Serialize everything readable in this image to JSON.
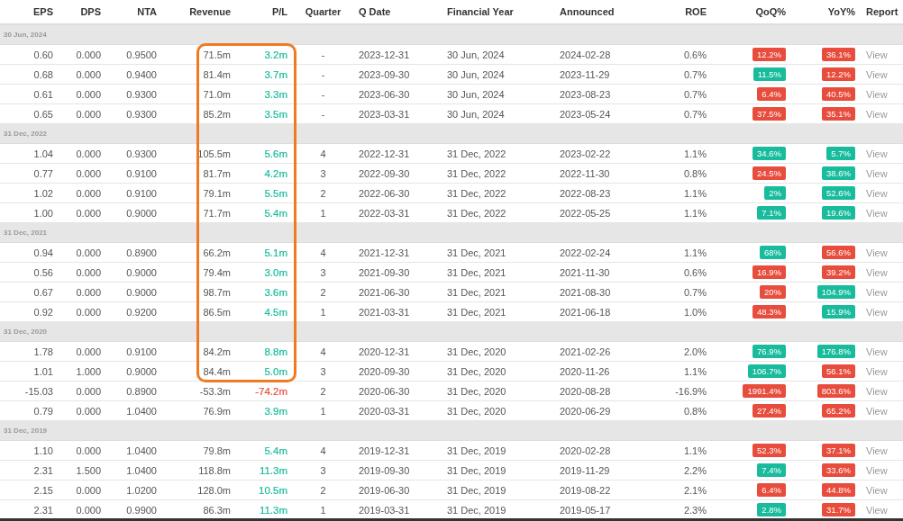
{
  "columns": [
    "EPS",
    "DPS",
    "NTA",
    "Revenue",
    "P/L",
    "Quarter",
    "Q Date",
    "Financial Year",
    "Announced",
    "ROE",
    "QoQ%",
    "YoY%",
    "Report"
  ],
  "groups": [
    {
      "label": "30 Jun, 2024",
      "rows": [
        {
          "eps": "0.60",
          "dps": "0.000",
          "nta": "0.9500",
          "revenue": "71.5m",
          "pl": {
            "text": "3.2m",
            "color": "#18bc9c"
          },
          "quarter": "-",
          "q_date": "2023-12-31",
          "financial_year": "30 Jun, 2024",
          "announced": "2024-02-28",
          "roe": "0.6%",
          "qoq": {
            "text": "12.2%",
            "color": "#e74c3c"
          },
          "yoy": {
            "text": "36.1%",
            "color": "#e74c3c"
          },
          "report": "View",
          "highlighted": true
        },
        {
          "eps": "0.68",
          "dps": "0.000",
          "nta": "0.9400",
          "revenue": "81.4m",
          "pl": {
            "text": "3.7m",
            "color": "#18bc9c"
          },
          "quarter": "-",
          "q_date": "2023-09-30",
          "financial_year": "30 Jun, 2024",
          "announced": "2023-11-29",
          "roe": "0.7%",
          "qoq": {
            "text": "11.5%",
            "color": "#18bc9c"
          },
          "yoy": {
            "text": "12.2%",
            "color": "#e74c3c"
          },
          "report": "View",
          "highlighted": true
        },
        {
          "eps": "0.61",
          "dps": "0.000",
          "nta": "0.9300",
          "revenue": "71.0m",
          "pl": {
            "text": "3.3m",
            "color": "#18bc9c"
          },
          "quarter": "-",
          "q_date": "2023-06-30",
          "financial_year": "30 Jun, 2024",
          "announced": "2023-08-23",
          "roe": "0.7%",
          "qoq": {
            "text": "6.4%",
            "color": "#e74c3c"
          },
          "yoy": {
            "text": "40.5%",
            "color": "#e74c3c"
          },
          "report": "View",
          "highlighted": true
        },
        {
          "eps": "0.65",
          "dps": "0.000",
          "nta": "0.9300",
          "revenue": "85.2m",
          "pl": {
            "text": "3.5m",
            "color": "#18bc9c"
          },
          "quarter": "-",
          "q_date": "2023-03-31",
          "financial_year": "30 Jun, 2024",
          "announced": "2023-05-24",
          "roe": "0.7%",
          "qoq": {
            "text": "37.5%",
            "color": "#e74c3c"
          },
          "yoy": {
            "text": "35.1%",
            "color": "#e74c3c"
          },
          "report": "View",
          "highlighted": true
        }
      ]
    },
    {
      "label": "31 Dec, 2022",
      "rows": [
        {
          "eps": "1.04",
          "dps": "0.000",
          "nta": "0.9300",
          "revenue": "105.5m",
          "pl": {
            "text": "5.6m",
            "color": "#18bc9c"
          },
          "quarter": "4",
          "q_date": "2022-12-31",
          "financial_year": "31 Dec, 2022",
          "announced": "2023-02-22",
          "roe": "1.1%",
          "qoq": {
            "text": "34.6%",
            "color": "#18bc9c"
          },
          "yoy": {
            "text": "5.7%",
            "color": "#18bc9c"
          },
          "report": "View",
          "highlighted": true
        },
        {
          "eps": "0.77",
          "dps": "0.000",
          "nta": "0.9100",
          "revenue": "81.7m",
          "pl": {
            "text": "4.2m",
            "color": "#18bc9c"
          },
          "quarter": "3",
          "q_date": "2022-09-30",
          "financial_year": "31 Dec, 2022",
          "announced": "2022-11-30",
          "roe": "0.8%",
          "qoq": {
            "text": "24.5%",
            "color": "#e74c3c"
          },
          "yoy": {
            "text": "38.6%",
            "color": "#18bc9c"
          },
          "report": "View",
          "highlighted": true
        },
        {
          "eps": "1.02",
          "dps": "0.000",
          "nta": "0.9100",
          "revenue": "79.1m",
          "pl": {
            "text": "5.5m",
            "color": "#18bc9c"
          },
          "quarter": "2",
          "q_date": "2022-06-30",
          "financial_year": "31 Dec, 2022",
          "announced": "2022-08-23",
          "roe": "1.1%",
          "qoq": {
            "text": "2%",
            "color": "#18bc9c"
          },
          "yoy": {
            "text": "52.6%",
            "color": "#18bc9c"
          },
          "report": "View",
          "highlighted": true
        },
        {
          "eps": "1.00",
          "dps": "0.000",
          "nta": "0.9000",
          "revenue": "71.7m",
          "pl": {
            "text": "5.4m",
            "color": "#18bc9c"
          },
          "quarter": "1",
          "q_date": "2022-03-31",
          "financial_year": "31 Dec, 2022",
          "announced": "2022-05-25",
          "roe": "1.1%",
          "qoq": {
            "text": "7.1%",
            "color": "#18bc9c"
          },
          "yoy": {
            "text": "19.6%",
            "color": "#18bc9c"
          },
          "report": "View",
          "highlighted": true
        }
      ]
    },
    {
      "label": "31 Dec, 2021",
      "rows": [
        {
          "eps": "0.94",
          "dps": "0.000",
          "nta": "0.8900",
          "revenue": "66.2m",
          "pl": {
            "text": "5.1m",
            "color": "#18bc9c"
          },
          "quarter": "4",
          "q_date": "2021-12-31",
          "financial_year": "31 Dec, 2021",
          "announced": "2022-02-24",
          "roe": "1.1%",
          "qoq": {
            "text": "68%",
            "color": "#18bc9c"
          },
          "yoy": {
            "text": "56.6%",
            "color": "#e74c3c"
          },
          "report": "View",
          "highlighted": true
        },
        {
          "eps": "0.56",
          "dps": "0.000",
          "nta": "0.9000",
          "revenue": "79.4m",
          "pl": {
            "text": "3.0m",
            "color": "#18bc9c"
          },
          "quarter": "3",
          "q_date": "2021-09-30",
          "financial_year": "31 Dec, 2021",
          "announced": "2021-11-30",
          "roe": "0.6%",
          "qoq": {
            "text": "16.9%",
            "color": "#e74c3c"
          },
          "yoy": {
            "text": "39.2%",
            "color": "#e74c3c"
          },
          "report": "View",
          "highlighted": true
        },
        {
          "eps": "0.67",
          "dps": "0.000",
          "nta": "0.9000",
          "revenue": "98.7m",
          "pl": {
            "text": "3.6m",
            "color": "#18bc9c"
          },
          "quarter": "2",
          "q_date": "2021-06-30",
          "financial_year": "31 Dec, 2021",
          "announced": "2021-08-30",
          "roe": "0.7%",
          "qoq": {
            "text": "20%",
            "color": "#e74c3c"
          },
          "yoy": {
            "text": "104.9%",
            "color": "#18bc9c"
          },
          "report": "View",
          "highlighted": true
        },
        {
          "eps": "0.92",
          "dps": "0.000",
          "nta": "0.9200",
          "revenue": "86.5m",
          "pl": {
            "text": "4.5m",
            "color": "#18bc9c"
          },
          "quarter": "1",
          "q_date": "2021-03-31",
          "financial_year": "31 Dec, 2021",
          "announced": "2021-06-18",
          "roe": "1.0%",
          "qoq": {
            "text": "48.3%",
            "color": "#e74c3c"
          },
          "yoy": {
            "text": "15.9%",
            "color": "#18bc9c"
          },
          "report": "View",
          "highlighted": true
        }
      ]
    },
    {
      "label": "31 Dec, 2020",
      "rows": [
        {
          "eps": "1.78",
          "dps": "0.000",
          "nta": "0.9100",
          "revenue": "84.2m",
          "pl": {
            "text": "8.8m",
            "color": "#18bc9c"
          },
          "quarter": "4",
          "q_date": "2020-12-31",
          "financial_year": "31 Dec, 2020",
          "announced": "2021-02-26",
          "roe": "2.0%",
          "qoq": {
            "text": "76.9%",
            "color": "#18bc9c"
          },
          "yoy": {
            "text": "176.8%",
            "color": "#18bc9c"
          },
          "report": "View",
          "highlighted": true
        },
        {
          "eps": "1.01",
          "dps": "1.000",
          "nta": "0.9000",
          "revenue": "84.4m",
          "pl": {
            "text": "5.0m",
            "color": "#18bc9c"
          },
          "quarter": "3",
          "q_date": "2020-09-30",
          "financial_year": "31 Dec, 2020",
          "announced": "2020-11-26",
          "roe": "1.1%",
          "qoq": {
            "text": "106.7%",
            "color": "#18bc9c"
          },
          "yoy": {
            "text": "56.1%",
            "color": "#e74c3c"
          },
          "report": "View",
          "highlighted": true
        },
        {
          "eps": "-15.03",
          "dps": "0.000",
          "nta": "0.8900",
          "revenue": "-53.3m",
          "pl": {
            "text": "-74.2m",
            "color": "#e74c3c"
          },
          "quarter": "2",
          "q_date": "2020-06-30",
          "financial_year": "31 Dec, 2020",
          "announced": "2020-08-28",
          "roe": "-16.9%",
          "qoq": {
            "text": "1991.4%",
            "color": "#e74c3c"
          },
          "yoy": {
            "text": "803.6%",
            "color": "#e74c3c"
          },
          "report": "View",
          "highlighted": false
        },
        {
          "eps": "0.79",
          "dps": "0.000",
          "nta": "1.0400",
          "revenue": "76.9m",
          "pl": {
            "text": "3.9m",
            "color": "#18bc9c"
          },
          "quarter": "1",
          "q_date": "2020-03-31",
          "financial_year": "31 Dec, 2020",
          "announced": "2020-06-29",
          "roe": "0.8%",
          "qoq": {
            "text": "27.4%",
            "color": "#e74c3c"
          },
          "yoy": {
            "text": "65.2%",
            "color": "#e74c3c"
          },
          "report": "View",
          "highlighted": false
        }
      ]
    },
    {
      "label": "31 Dec, 2019",
      "rows": [
        {
          "eps": "1.10",
          "dps": "0.000",
          "nta": "1.0400",
          "revenue": "79.8m",
          "pl": {
            "text": "5.4m",
            "color": "#18bc9c"
          },
          "quarter": "4",
          "q_date": "2019-12-31",
          "financial_year": "31 Dec, 2019",
          "announced": "2020-02-28",
          "roe": "1.1%",
          "qoq": {
            "text": "52.3%",
            "color": "#e74c3c"
          },
          "yoy": {
            "text": "37.1%",
            "color": "#e74c3c"
          },
          "report": "View",
          "highlighted": false
        },
        {
          "eps": "2.31",
          "dps": "1.500",
          "nta": "1.0400",
          "revenue": "118.8m",
          "pl": {
            "text": "11.3m",
            "color": "#18bc9c"
          },
          "quarter": "3",
          "q_date": "2019-09-30",
          "financial_year": "31 Dec, 2019",
          "announced": "2019-11-29",
          "roe": "2.2%",
          "qoq": {
            "text": "7.4%",
            "color": "#18bc9c"
          },
          "yoy": {
            "text": "33.6%",
            "color": "#e74c3c"
          },
          "report": "View",
          "highlighted": false
        },
        {
          "eps": "2.15",
          "dps": "0.000",
          "nta": "1.0200",
          "revenue": "128.0m",
          "pl": {
            "text": "10.5m",
            "color": "#18bc9c"
          },
          "quarter": "2",
          "q_date": "2019-06-30",
          "financial_year": "31 Dec, 2019",
          "announced": "2019-08-22",
          "roe": "2.1%",
          "qoq": {
            "text": "6.4%",
            "color": "#e74c3c"
          },
          "yoy": {
            "text": "44.8%",
            "color": "#e74c3c"
          },
          "report": "View",
          "highlighted": false
        },
        {
          "eps": "2.31",
          "dps": "0.000",
          "nta": "0.9900",
          "revenue": "86.3m",
          "pl": {
            "text": "11.3m",
            "color": "#18bc9c"
          },
          "quarter": "1",
          "q_date": "2019-03-31",
          "financial_year": "31 Dec, 2019",
          "announced": "2019-05-17",
          "roe": "2.3%",
          "qoq": {
            "text": "2.8%",
            "color": "#18bc9c"
          },
          "yoy": {
            "text": "31.7%",
            "color": "#e74c3c"
          },
          "report": "View",
          "highlighted": false
        }
      ]
    }
  ]
}
